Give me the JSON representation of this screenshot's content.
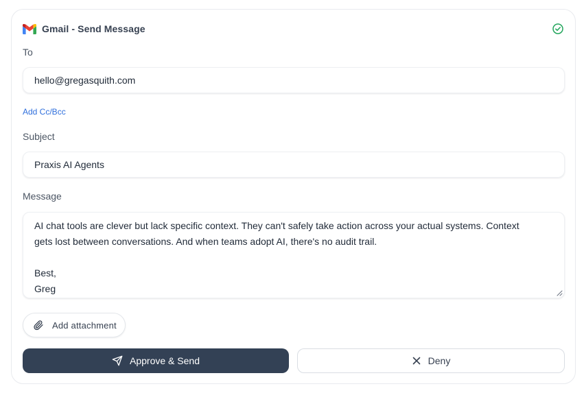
{
  "header": {
    "title": "Gmail - Send Message",
    "logo_icon": "gmail-logo-icon",
    "status_icon": "check-circle-icon",
    "status_color": "#22a55b"
  },
  "to": {
    "label": "To",
    "value": "hello@gregasquith.com"
  },
  "cc_bcc_link": "Add Cc/Bcc",
  "subject": {
    "label": "Subject",
    "value": "Praxis AI Agents"
  },
  "message": {
    "label": "Message",
    "lines": [
      "AI chat tools are clever but lack specific context. They can't safely take action across your actual systems. Context",
      "gets lost between conversations. And when teams adopt AI, there's no audit trail.",
      "",
      "Best,",
      "Greg"
    ]
  },
  "attachment": {
    "label": "Add attachment",
    "icon": "paperclip-icon"
  },
  "actions": {
    "approve_label": "Approve & Send",
    "approve_icon": "send-icon",
    "approve_color": "#334155",
    "deny_label": "Deny",
    "deny_icon": "close-icon"
  },
  "colors": {
    "link": "#2f6fdc"
  }
}
